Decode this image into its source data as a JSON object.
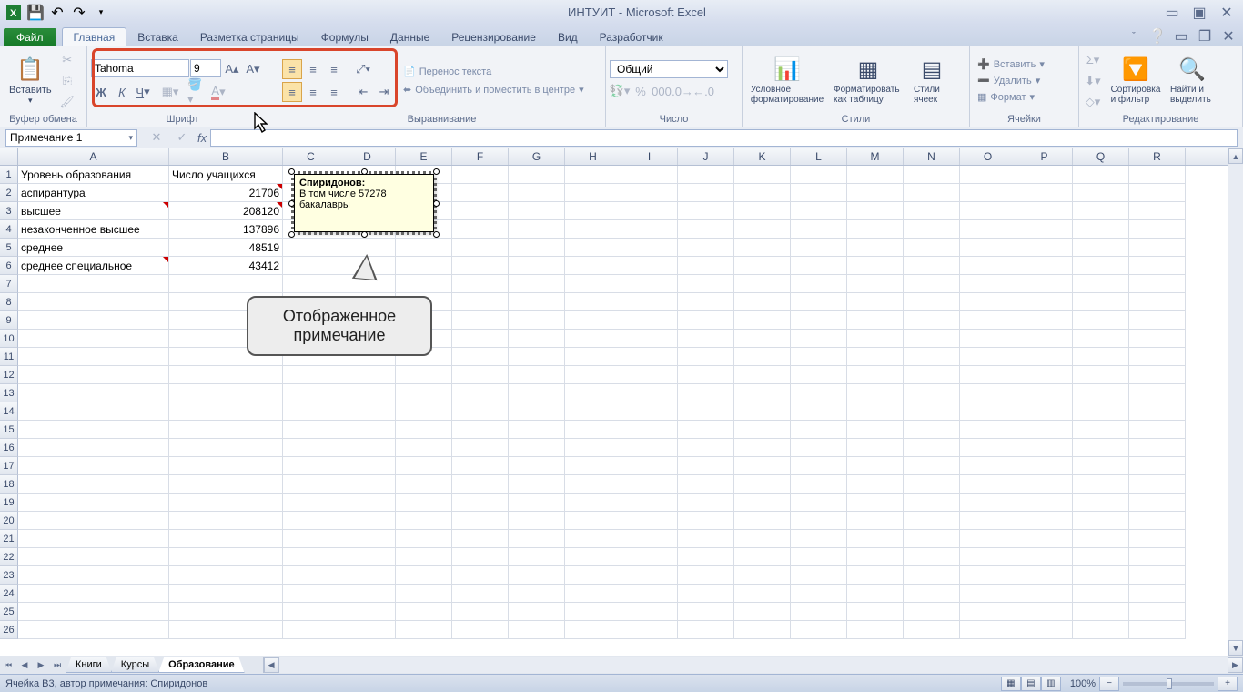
{
  "title": "ИНТУИТ - Microsoft Excel",
  "tabs": {
    "file": "Файл",
    "items": [
      "Главная",
      "Вставка",
      "Разметка страницы",
      "Формулы",
      "Данные",
      "Рецензирование",
      "Вид",
      "Разработчик"
    ]
  },
  "groups": {
    "clipboard": {
      "label": "Буфер обмена",
      "paste": "Вставить"
    },
    "font": {
      "label": "Шрифт",
      "name": "Tahoma",
      "size": "9"
    },
    "alignment": {
      "label": "Выравнивание",
      "wrap": "Перенос текста",
      "merge": "Объединить и поместить в центре"
    },
    "number": {
      "label": "Число",
      "format": "Общий"
    },
    "styles": {
      "label": "Стили",
      "cond": "Условное форматирование",
      "table": "Форматировать как таблицу",
      "cell": "Стили ячеек"
    },
    "cells": {
      "label": "Ячейки",
      "insert": "Вставить",
      "delete": "Удалить",
      "format": "Формат"
    },
    "editing": {
      "label": "Редактирование",
      "sort": "Сортировка и фильтр",
      "find": "Найти и выделить"
    }
  },
  "nameBox": "Примечание 1",
  "columns": [
    "A",
    "B",
    "C",
    "D",
    "E",
    "F",
    "G",
    "H",
    "I",
    "J",
    "K",
    "L",
    "M",
    "N",
    "O",
    "P",
    "Q",
    "R"
  ],
  "colWidths": {
    "A": 166,
    "B": 125,
    "default": 62
  },
  "rows": 26,
  "data": {
    "A1": "Уровень образования",
    "B1": "Число учащихся",
    "A2": "аспирантура",
    "B2": "21706",
    "A3": "высшее",
    "B3": "208120",
    "A4": "незаконченное высшее",
    "B4": "137896",
    "A5": "среднее",
    "B5": "48519",
    "A6": "среднее специальное",
    "B6": "43412"
  },
  "commentIndicators": [
    "B2",
    "A3",
    "B3",
    "A6"
  ],
  "comment": {
    "author": "Спиридонов:",
    "text1": "В том числе 57278",
    "text2": "бакалавры"
  },
  "callout": {
    "line1": "Отображенное",
    "line2": "примечание"
  },
  "sheets": [
    "Книги",
    "Курсы",
    "Образование"
  ],
  "activeSheet": 2,
  "status": "Ячейка B3, автор примечания: Спиридонов",
  "zoom": "100%"
}
